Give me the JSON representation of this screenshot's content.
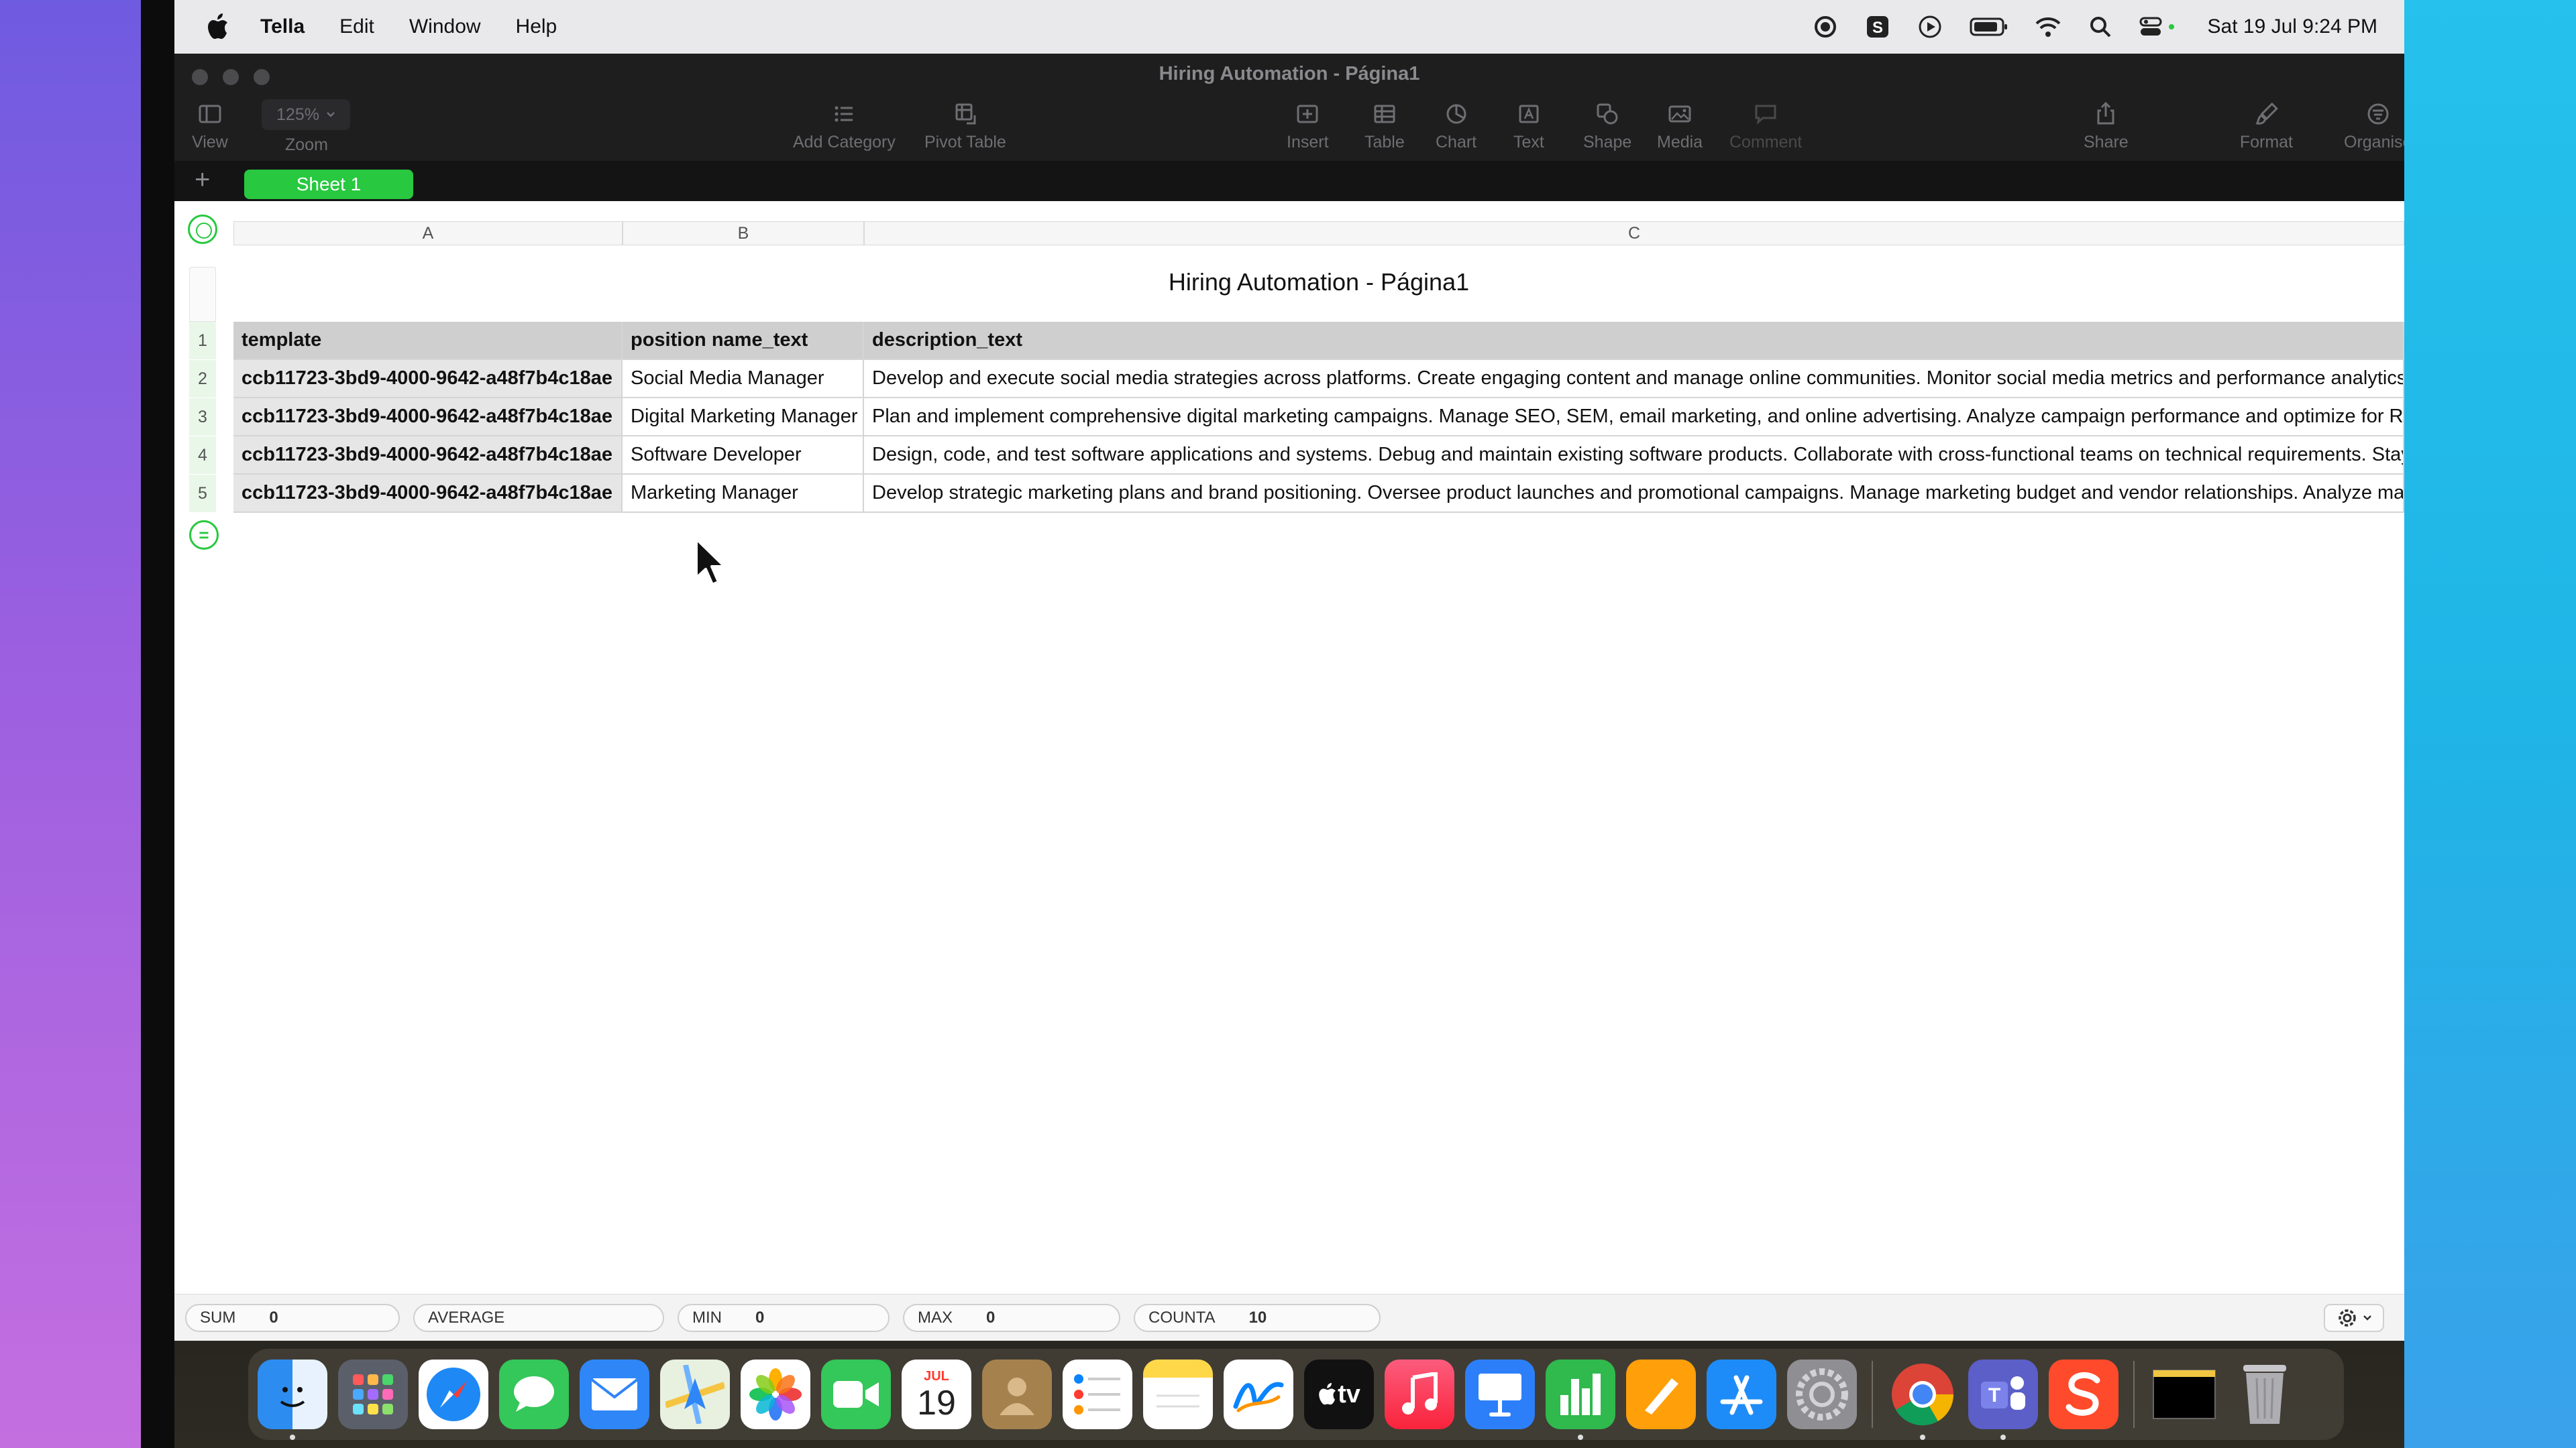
{
  "menubar": {
    "app_name": "Tella",
    "menus": [
      "Edit",
      "Window",
      "Help"
    ],
    "clock": "Sat 19 Jul  9:24 PM"
  },
  "window": {
    "title": "Hiring Automation - Página1"
  },
  "toolbar": {
    "view": "View",
    "zoom_value": "125%",
    "zoom": "Zoom",
    "add_category": "Add Category",
    "pivot_table": "Pivot Table",
    "insert": "Insert",
    "table": "Table",
    "chart": "Chart",
    "text": "Text",
    "shape": "Shape",
    "media": "Media",
    "comment": "Comment",
    "share": "Share",
    "format": "Format",
    "organise": "Organise"
  },
  "sheets": {
    "add": "+",
    "active": "Sheet 1"
  },
  "spreadsheet": {
    "columns": [
      "A",
      "B",
      "C"
    ],
    "table_title": "Hiring Automation - Página1",
    "row_numbers": [
      "1",
      "2",
      "3",
      "4",
      "5"
    ],
    "header": [
      "template",
      "position name_text",
      "description_text"
    ],
    "rows": [
      [
        "ccb11723-3bd9-4000-9642-a48f7b4c18ae",
        "Social Media Manager",
        "Develop and execute social media strategies across platforms. Create engaging content and manage online communities. Monitor social media metrics and performance analytics. C"
      ],
      [
        "ccb11723-3bd9-4000-9642-a48f7b4c18ae",
        "Digital Marketing Manager",
        "Plan and implement comprehensive digital marketing campaigns. Manage SEO, SEM, email marketing, and online advertising. Analyze campaign performance and optimize for ROI."
      ],
      [
        "ccb11723-3bd9-4000-9642-a48f7b4c18ae",
        "Software Developer",
        "Design, code, and test software applications and systems. Debug and maintain existing software products. Collaborate with cross-functional teams on technical requirements. Stay u"
      ],
      [
        "ccb11723-3bd9-4000-9642-a48f7b4c18ae",
        "Marketing Manager",
        "Develop strategic marketing plans and brand positioning. Oversee product launches and promotional campaigns. Manage marketing budget and vendor relationships. Analyze marke"
      ]
    ]
  },
  "statusbar": {
    "sum_label": "SUM",
    "sum_value": "0",
    "average_label": "AVERAGE",
    "average_value": "",
    "min_label": "MIN",
    "min_value": "0",
    "max_label": "MAX",
    "max_value": "0",
    "counta_label": "COUNTA",
    "counta_value": "10"
  },
  "dock": {
    "calendar_month": "JUL",
    "calendar_day": "19",
    "apps": [
      "finder-icon",
      "launchpad-icon",
      "safari-icon",
      "messages-icon",
      "mail-icon",
      "maps-icon",
      "photos-icon",
      "facetime-icon",
      "calendar-icon",
      "contacts-icon",
      "reminders-icon",
      "notes-icon",
      "freeform-icon",
      "apple-tv-icon",
      "music-icon",
      "keynote-icon",
      "numbers-icon",
      "pages-icon",
      "app-store-icon",
      "system-settings-icon",
      "chrome-icon",
      "teams-icon",
      "s-app-icon",
      "window-preview",
      "trash-icon"
    ],
    "tv_label": "tv"
  },
  "colors": {
    "accent_green": "#28c840",
    "toolbar_bg": "#1e1e1e",
    "header_row": "#cfcfcf",
    "id_column": "#e6e6e6"
  }
}
